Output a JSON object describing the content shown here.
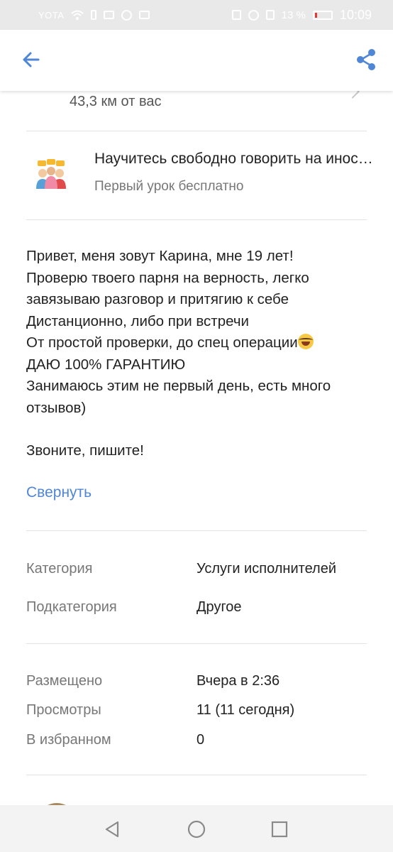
{
  "status_bar": {
    "carrier": "YOTA",
    "battery": "13 %",
    "time": "10:09"
  },
  "app_bar": {
    "back_icon": "arrow-left-icon",
    "share_icon": "share-icon",
    "accent_color": "#4f86d6"
  },
  "location": {
    "distance": "43,3 км от вас"
  },
  "promo": {
    "icon": "people-chat-icon",
    "title": "Научитесь свободно говорить на иностранном",
    "subtitle": "Первый урок бесплатно"
  },
  "description": {
    "lines": [
      "Привет, меня зовут Карина, мне 19 лет!",
      "Проверю твоего парня на верность, легко",
      "завязываю разговор и притягию к себе",
      "Дистанционно, либо при встречи",
      "От простой проверки, до спец операции",
      "ДАЮ 100% ГАРАНТИЮ",
      "Занимаюсь этим не первый день, есть много",
      "отзывов)"
    ],
    "closing": "Звоните, пишите!",
    "collapse_label": "Свернуть"
  },
  "category": {
    "label": "Категория",
    "value": "Услуги исполнителей"
  },
  "subcategory": {
    "label": "Подкатегория",
    "value": "Другое"
  },
  "stats": {
    "posted_label": "Размещено",
    "posted_value": "Вчера в 2:36",
    "views_label": "Просмотры",
    "views_value": "11 (11 сегодня)",
    "favorites_label": "В избранном",
    "favorites_value": "0"
  },
  "nav": {
    "back_icon": "triangle-back-icon",
    "home_icon": "circle-home-icon",
    "recents_icon": "square-recents-icon"
  }
}
